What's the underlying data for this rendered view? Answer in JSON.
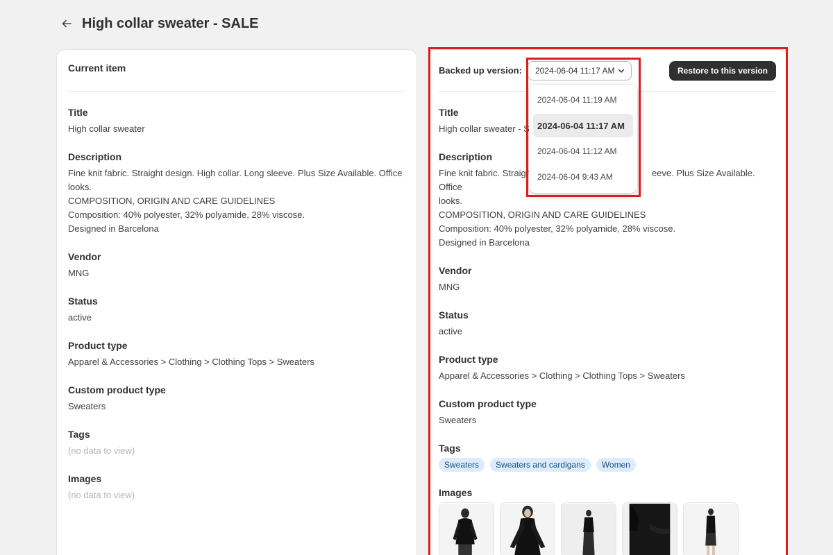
{
  "header": {
    "title": "High collar sweater - SALE"
  },
  "left": {
    "heading": "Current item",
    "fields": {
      "title_label": "Title",
      "title_value": "High collar sweater",
      "description_label": "Description",
      "description_lines": [
        "Fine knit fabric. Straight design. High collar. Long sleeve. Plus Size Available. Office",
        "looks.",
        "COMPOSITION, ORIGIN AND CARE GUIDELINES",
        "Composition: 40% polyester, 32% polyamide, 28% viscose.",
        "Designed in Barcelona"
      ],
      "vendor_label": "Vendor",
      "vendor_value": "MNG",
      "status_label": "Status",
      "status_value": "active",
      "product_type_label": "Product type",
      "product_type_value": "Apparel & Accessories > Clothing > Clothing Tops > Sweaters",
      "custom_type_label": "Custom product type",
      "custom_type_value": "Sweaters",
      "tags_label": "Tags",
      "tags_empty": "(no data to view)",
      "images_label": "Images",
      "images_empty": "(no data to view)"
    }
  },
  "right": {
    "version_label": "Backed up version:",
    "selected_version": "2024-06-04 11:17 AM",
    "restore_label": "Restore to this version",
    "version_options": [
      "2024-06-04 11:19 AM",
      "2024-06-04 11:17 AM",
      "2024-06-04 11:12 AM",
      "2024-06-04 9:43 AM"
    ],
    "fields": {
      "title_label": "Title",
      "title_value_visible": "High collar sweater - S",
      "description_label": "Description",
      "description_lines": [
        "Fine knit fabric. Straigh",
        "looks.",
        "COMPOSITION, ORIGIN AND CARE GUIDELINES",
        "Composition: 40% polyester, 32% polyamide, 28% viscose.",
        "Designed in Barcelona"
      ],
      "description_line1_tail": "eeve. Plus Size Available. Office",
      "vendor_label": "Vendor",
      "vendor_value": "MNG",
      "status_label": "Status",
      "status_value": "active",
      "product_type_label": "Product type",
      "product_type_value": "Apparel & Accessories > Clothing > Clothing Tops > Sweaters",
      "custom_type_label": "Custom product type",
      "custom_type_value": "Sweaters",
      "tags_label": "Tags",
      "tags": [
        "Sweaters",
        "Sweaters and cardigans",
        "Women"
      ],
      "images_label": "Images"
    }
  },
  "colors": {
    "highlight": "#e01b1b",
    "tag_bg": "#dcecfb",
    "tag_text": "#1f4e7a",
    "button_bg": "#303030"
  },
  "icons": {
    "back": "arrow-left-icon",
    "dropdown": "chevron-down-icon"
  }
}
